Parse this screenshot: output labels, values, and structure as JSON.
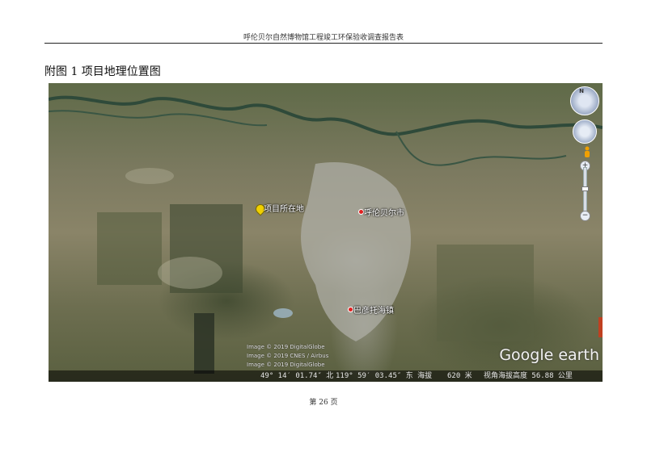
{
  "header": {
    "title": "呼伦贝尔自然博物馆工程竣工环保验收调查报告表"
  },
  "figure": {
    "caption": "附图 1 项目地理位置图"
  },
  "map": {
    "labels": {
      "project": "项目所在地",
      "city": "呼伦贝尔市",
      "town": "巴彦托海镇"
    },
    "credits": [
      "Image © 2019 DigitalGlobe",
      "Image © 2019 CNES / Airbus",
      "Image © 2019 DigitalGlobe"
    ],
    "brand": "Google earth",
    "nav_north": "N",
    "zoom_in": "+",
    "zoom_out": "−",
    "status": {
      "lat": "49° 14′ 01.74″ 北",
      "lon": "119° 59′ 03.45″ 东 海拔",
      "elevation": "620 米",
      "eye_alt": "视角海拔高度 56.88 公里"
    },
    "colors": {
      "river": "#2f4a3a",
      "urban": "#b8b8b0",
      "pin": "#f0d000",
      "marker": "#e02020"
    }
  },
  "footer": {
    "page": "第 26 页"
  }
}
